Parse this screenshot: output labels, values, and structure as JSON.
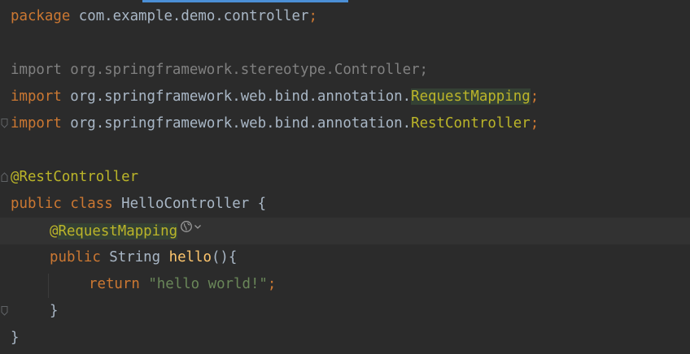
{
  "editor": {
    "accent_color": "#4b8fd6",
    "background": "#2b2b2b",
    "lines": {
      "l1": {
        "kw_package": "package",
        "pkg_name": " com.example.demo.controller",
        "semi": ";"
      },
      "l3": {
        "text": "import org.springframework.stereotype.Controller;"
      },
      "l4": {
        "kw_import": "import",
        "path": " org.springframework.web.bind.annotation.",
        "cls": "RequestMapping",
        "semi": ";"
      },
      "l5": {
        "kw_import": "import",
        "path": " org.springframework.web.bind.annotation.",
        "cls": "RestController",
        "semi": ";"
      },
      "l7": {
        "annotation": "@RestController"
      },
      "l8": {
        "kw_public": "public",
        "kw_class": "class",
        "class_name": " HelloController {"
      },
      "l9": {
        "at": "@",
        "annotation": "RequestMapping",
        "icons": [
          "globe-icon",
          "chevron-down-icon"
        ]
      },
      "l10": {
        "kw_public": "public",
        "type": " String ",
        "method": "hello",
        "rest": "(){"
      },
      "l11": {
        "kw_return": "return",
        "string": "\"hello world!\"",
        "semi": ";"
      },
      "l12": {
        "brace": "}"
      },
      "l13": {
        "brace": "}"
      }
    }
  }
}
